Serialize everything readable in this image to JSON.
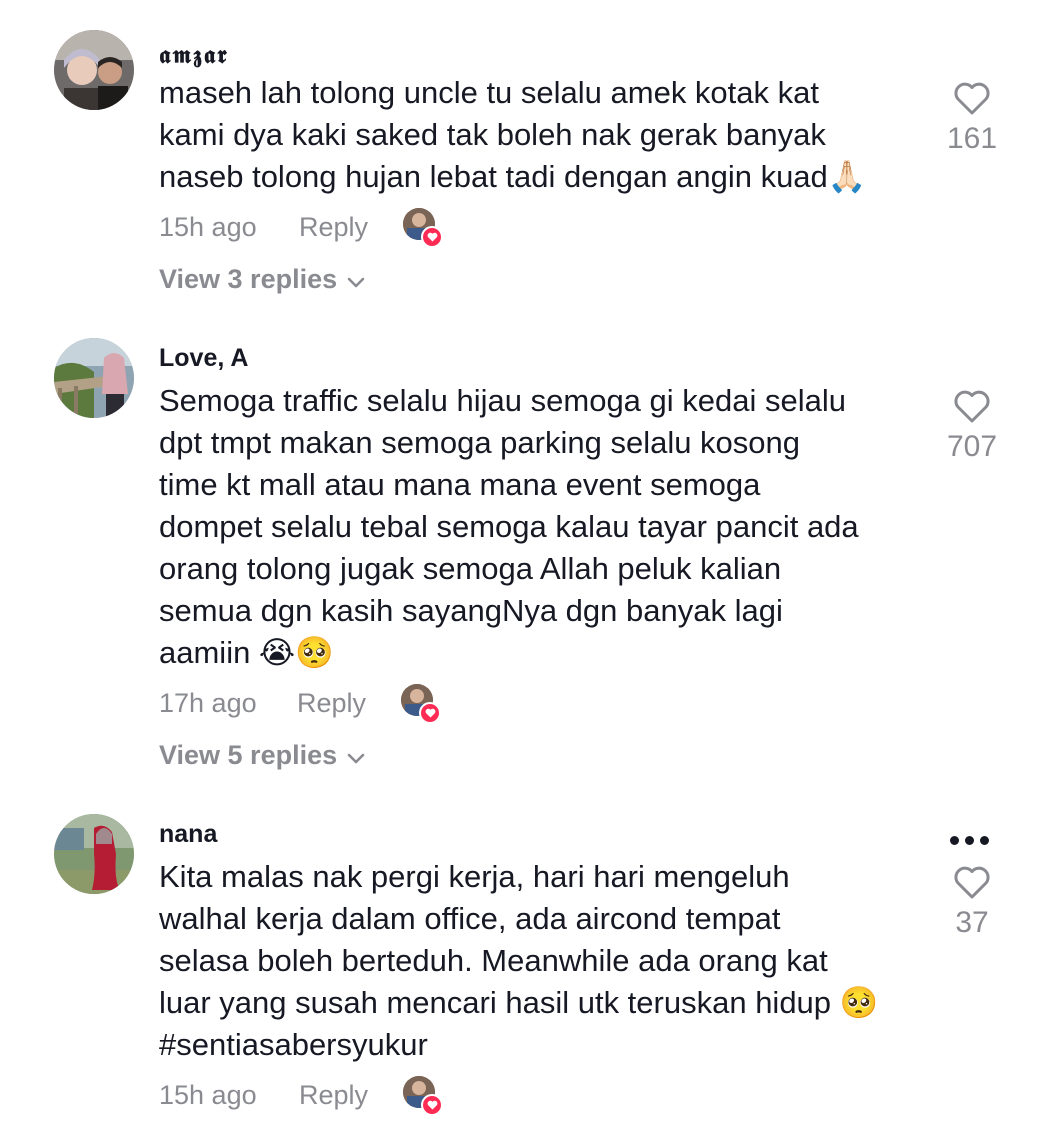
{
  "comments": [
    {
      "username": "𝖆𝖒𝖟𝖆𝖗",
      "text": "maseh lah tolong uncle tu selalu amek kotak kat\nkami dya kaki saked tak boleh nak gerak banyak\nnaseb tolong hujan lebat tadi dengan angin kuad🙏🏻",
      "time": "15h ago",
      "reply_label": "Reply",
      "view_replies": "View 3 replies",
      "likes": "161"
    },
    {
      "username": "Love, A",
      "text": "Semoga traffic selalu hijau semoga gi kedai selalu\ndpt tmpt makan semoga parking selalu kosong\ntime kt mall atau mana mana event semoga\ndompet selalu tebal semoga kalau tayar pancit ada\norang tolong jugak semoga Allah peluk kalian\nsemua dgn kasih sayangNya dgn banyak lagi\naamiin 😭🥺",
      "time": "17h ago",
      "reply_label": "Reply",
      "view_replies": "View 5 replies",
      "likes": "707"
    },
    {
      "username": "nana",
      "text": "Kita malas nak pergi kerja, hari hari mengeluh\nwalhal kerja dalam office, ada aircond tempat\nselasa boleh berteduh. Meanwhile ada orang kat\nluar yang susah mencari hasil utk teruskan hidup 🥺\n#sentiasabersyukur",
      "time": "15h ago",
      "reply_label": "Reply",
      "likes": "37"
    }
  ],
  "colors": {
    "primary_text": "#161823",
    "secondary_text": "#8a8b91",
    "like_badge": "#fe2c55"
  },
  "icons": {
    "like": "heart-outline-icon",
    "creator_liked": "creator-liked-badge-icon",
    "expand": "chevron-down-icon",
    "more": "more-options-icon"
  }
}
